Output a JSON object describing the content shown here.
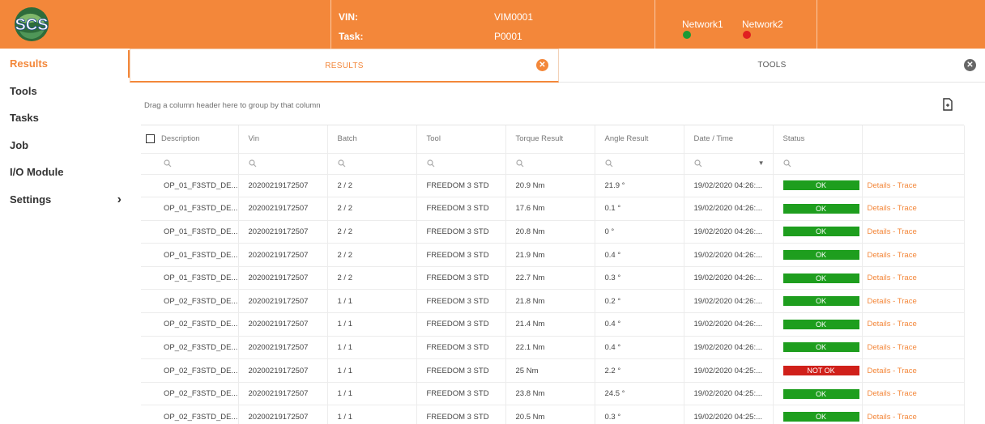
{
  "header": {
    "logo_text": "SCS",
    "vin_label": "VIN:",
    "vin_value": "VIM0001",
    "task_label": "Task:",
    "task_value": "P0001",
    "networks": [
      {
        "label": "Network1",
        "color": "#1a9a35"
      },
      {
        "label": "Network2",
        "color": "#e02020"
      }
    ]
  },
  "sidebar": {
    "items": [
      {
        "label": "Results",
        "active": true
      },
      {
        "label": "Tools"
      },
      {
        "label": "Tasks"
      },
      {
        "label": "Job"
      },
      {
        "label": "I/O Module"
      },
      {
        "label": "Settings",
        "has_submenu": true
      }
    ]
  },
  "tabs": [
    {
      "label": "RESULTS",
      "active": true,
      "close_color": "#f3873a"
    },
    {
      "label": "TOOLS",
      "active": false,
      "close_color": "#666666"
    }
  ],
  "grid": {
    "group_hint": "Drag a column header here to group by that column",
    "columns": [
      "Description",
      "Vin",
      "Batch",
      "Tool",
      "Torque Result",
      "Angle Result",
      "Date / Time",
      "Status",
      ""
    ],
    "rows": [
      {
        "description": "OP_01_F3STD_DE...",
        "vin": "20200219172507",
        "batch": "2 / 2",
        "tool": "FREEDOM 3 STD",
        "torque": "20.9 Nm",
        "angle": "21.9 °",
        "datetime": "19/02/2020 04:26:...",
        "status": "OK",
        "link": "Details - Trace"
      },
      {
        "description": "OP_01_F3STD_DE...",
        "vin": "20200219172507",
        "batch": "2 / 2",
        "tool": "FREEDOM 3 STD",
        "torque": "17.6 Nm",
        "angle": "0.1 °",
        "datetime": "19/02/2020 04:26:...",
        "status": "OK",
        "link": "Details - Trace"
      },
      {
        "description": "OP_01_F3STD_DE...",
        "vin": "20200219172507",
        "batch": "2 / 2",
        "tool": "FREEDOM 3 STD",
        "torque": "20.8 Nm",
        "angle": "0 °",
        "datetime": "19/02/2020 04:26:...",
        "status": "OK",
        "link": "Details - Trace"
      },
      {
        "description": "OP_01_F3STD_DE...",
        "vin": "20200219172507",
        "batch": "2 / 2",
        "tool": "FREEDOM 3 STD",
        "torque": "21.9 Nm",
        "angle": "0.4 °",
        "datetime": "19/02/2020 04:26:...",
        "status": "OK",
        "link": "Details - Trace"
      },
      {
        "description": "OP_01_F3STD_DE...",
        "vin": "20200219172507",
        "batch": "2 / 2",
        "tool": "FREEDOM 3 STD",
        "torque": "22.7 Nm",
        "angle": "0.3 °",
        "datetime": "19/02/2020 04:26:...",
        "status": "OK",
        "link": "Details - Trace"
      },
      {
        "description": "OP_02_F3STD_DE...",
        "vin": "20200219172507",
        "batch": "1 / 1",
        "tool": "FREEDOM 3 STD",
        "torque": "21.8 Nm",
        "angle": "0.2 °",
        "datetime": "19/02/2020 04:26:...",
        "status": "OK",
        "link": "Details - Trace"
      },
      {
        "description": "OP_02_F3STD_DE...",
        "vin": "20200219172507",
        "batch": "1 / 1",
        "tool": "FREEDOM 3 STD",
        "torque": "21.4 Nm",
        "angle": "0.4 °",
        "datetime": "19/02/2020 04:26:...",
        "status": "OK",
        "link": "Details - Trace"
      },
      {
        "description": "OP_02_F3STD_DE...",
        "vin": "20200219172507",
        "batch": "1 / 1",
        "tool": "FREEDOM 3 STD",
        "torque": "22.1 Nm",
        "angle": "0.4 °",
        "datetime": "19/02/2020 04:26:...",
        "status": "OK",
        "link": "Details - Trace"
      },
      {
        "description": "OP_02_F3STD_DE...",
        "vin": "20200219172507",
        "batch": "1 / 1",
        "tool": "FREEDOM 3 STD",
        "torque": "25 Nm",
        "angle": "2.2 °",
        "datetime": "19/02/2020 04:25:...",
        "status": "NOT OK",
        "link": "Details - Trace"
      },
      {
        "description": "OP_02_F3STD_DE...",
        "vin": "20200219172507",
        "batch": "1 / 1",
        "tool": "FREEDOM 3 STD",
        "torque": "23.8 Nm",
        "angle": "24.5 °",
        "datetime": "19/02/2020 04:25:...",
        "status": "OK",
        "link": "Details - Trace"
      },
      {
        "description": "OP_02_F3STD_DE...",
        "vin": "20200219172507",
        "batch": "1 / 1",
        "tool": "FREEDOM 3 STD",
        "torque": "20.5 Nm",
        "angle": "0.3 °",
        "datetime": "19/02/2020 04:25:...",
        "status": "OK",
        "link": "Details - Trace"
      }
    ]
  },
  "colors": {
    "brand": "#f3873a",
    "ok": "#1e9e1e",
    "not_ok": "#d0201a"
  }
}
